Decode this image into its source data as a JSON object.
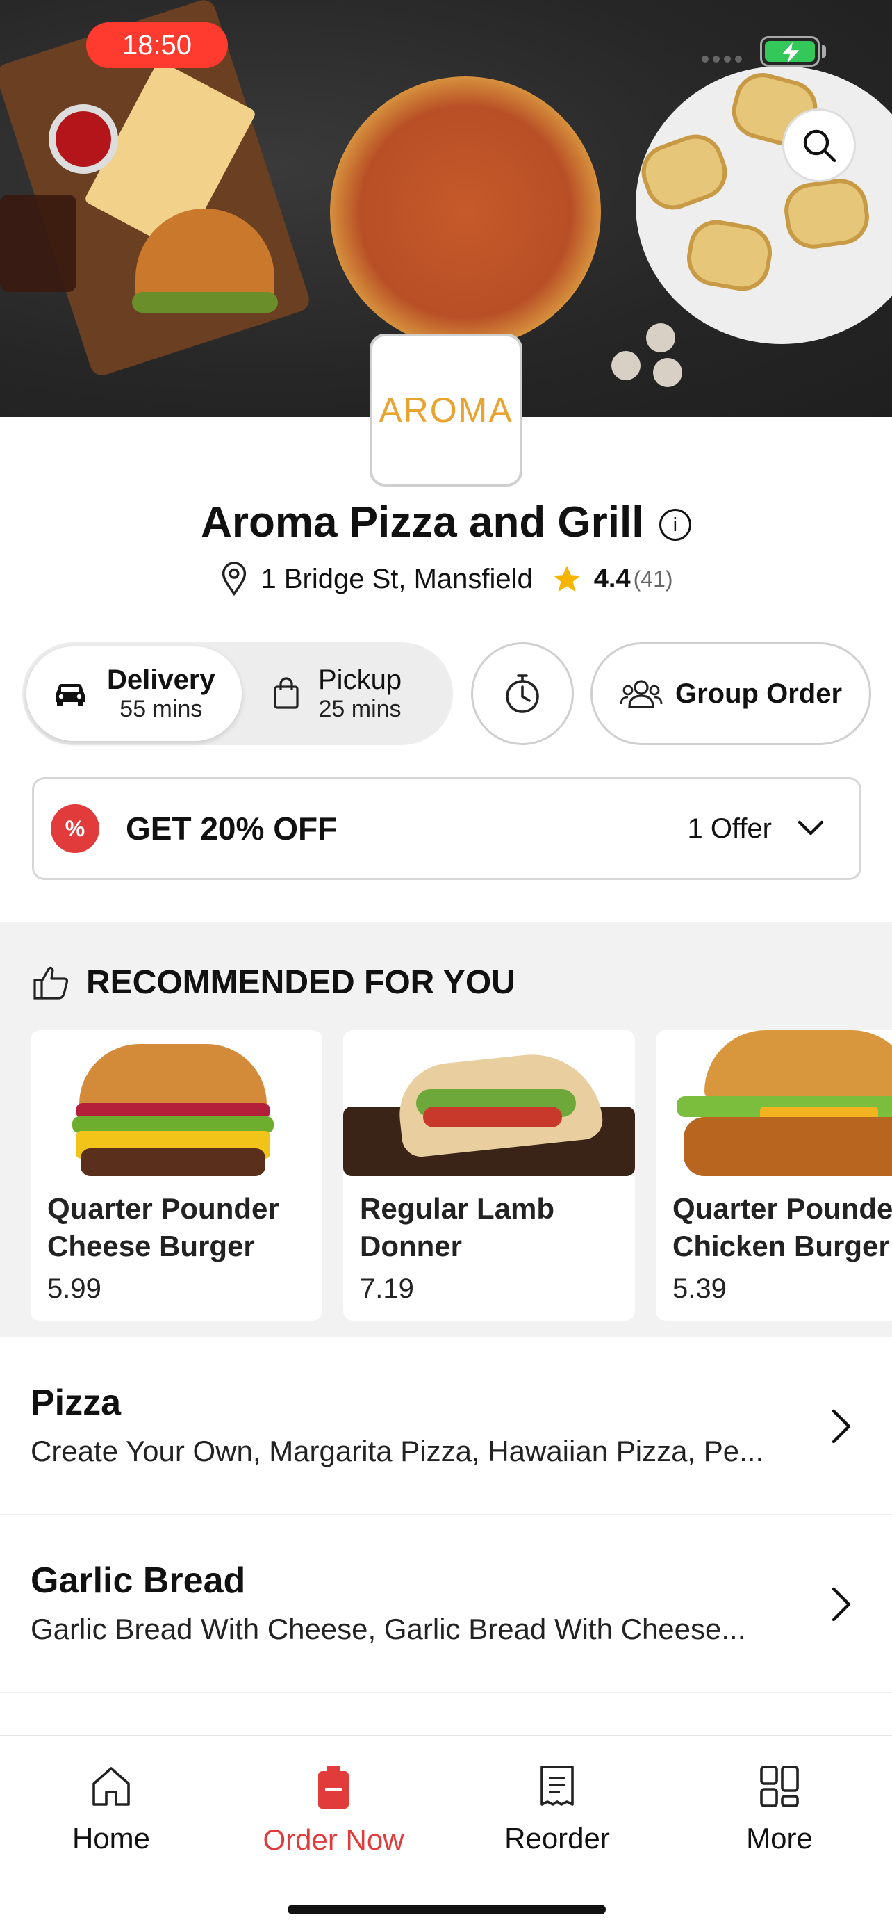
{
  "status_bar": {
    "time": "18:50"
  },
  "brand": {
    "logo_text": "AROMA",
    "accent_color": "#e23b3b",
    "logo_color": "#e9a330"
  },
  "restaurant": {
    "name": "Aroma Pizza and Grill",
    "address": "1 Bridge St, Mansfield",
    "rating": "4.4",
    "rating_count": "(41)"
  },
  "order_mode": {
    "delivery": {
      "label": "Delivery",
      "time": "55 mins",
      "selected": true
    },
    "pickup": {
      "label": "Pickup",
      "time": "25 mins",
      "selected": false
    }
  },
  "group_order_label": "Group Order",
  "offer": {
    "badge": "%",
    "title": "GET 20% OFF",
    "count": "1 Offer"
  },
  "recommended": {
    "title": "RECOMMENDED FOR YOU",
    "items": [
      {
        "name": "Quarter Pounder Cheese Burger",
        "price": "5.99"
      },
      {
        "name": "Regular Lamb Donner",
        "price": "7.19"
      },
      {
        "name": "Quarter Pounder Chicken Burger",
        "price": "5.39"
      }
    ]
  },
  "categories": [
    {
      "title": "Pizza",
      "items": "Create Your Own, Margarita Pizza, Hawaiian Pizza, Pe..."
    },
    {
      "title": "Garlic Bread",
      "items": "Garlic Bread With Cheese, Garlic Bread With Cheese..."
    }
  ],
  "tabbar": [
    {
      "label": "Home",
      "icon": "home-icon",
      "active": false
    },
    {
      "label": "Order Now",
      "icon": "order-icon",
      "active": true
    },
    {
      "label": "Reorder",
      "icon": "receipt-icon",
      "active": false
    },
    {
      "label": "More",
      "icon": "grid-icon",
      "active": false
    }
  ]
}
